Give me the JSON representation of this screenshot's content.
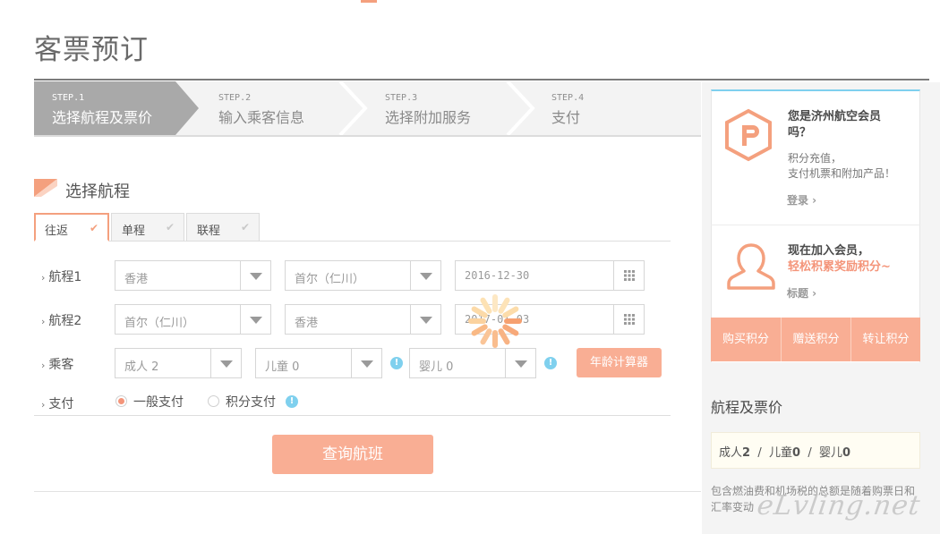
{
  "page": {
    "title": "客票预订"
  },
  "steps": [
    {
      "num": "STEP.1",
      "label": "选择航程及票价",
      "active": true
    },
    {
      "num": "STEP.2",
      "label": "输入乘客信息",
      "active": false
    },
    {
      "num": "STEP.3",
      "label": "选择附加服务",
      "active": false
    },
    {
      "num": "STEP.4",
      "label": "支付",
      "active": false
    }
  ],
  "section": {
    "title": "选择航程"
  },
  "trip_tabs": [
    {
      "label": "往返",
      "selected": true
    },
    {
      "label": "单程",
      "selected": false
    },
    {
      "label": "联程",
      "selected": false
    }
  ],
  "segment1": {
    "label": "航程1",
    "from": "香港",
    "to": "首尔（仁川）",
    "date": "2016-12-30"
  },
  "segment2": {
    "label": "航程2",
    "from": "首尔（仁川）",
    "to": "香港",
    "date": "2017-01-03"
  },
  "passengers": {
    "label": "乘客",
    "adult": "成人 2",
    "child": "儿童 0",
    "infant": "婴儿 0",
    "info_icon": "info-icon",
    "age_calc_label": "年龄计算器"
  },
  "payment": {
    "label": "支付",
    "option_normal": "一般支付",
    "option_points": "积分支付",
    "selected": "一般支付"
  },
  "search_button": "查询航班",
  "sidebar": {
    "member": {
      "question_line1": "您是济州航空会员",
      "question_line2": "吗？",
      "desc_line1": "积分充值，",
      "desc_line2": "支付机票和附加产品！",
      "login_link": "登录 ›",
      "join_line1": "现在加入会员，",
      "join_line2": "轻松积累奖励积分~",
      "join_link": "标题 ›"
    },
    "points_buttons": [
      "购买积分",
      "赠送积分",
      "转让积分"
    ],
    "fare": {
      "title": "航程及票价",
      "adult_label": "成人",
      "adult_count": "2",
      "child_label": "儿童",
      "child_count": "0",
      "infant_label": "婴儿",
      "infant_count": "0",
      "sep": "/",
      "note": "包含燃油费和机场税的总额是随着购票日和汇率变动"
    }
  },
  "watermark": "eLvling.net",
  "colors": {
    "accent": "#f9ae94",
    "accent_dark": "#f4957a",
    "info": "#7fd0ee",
    "step_active": "#a9a9a9"
  }
}
